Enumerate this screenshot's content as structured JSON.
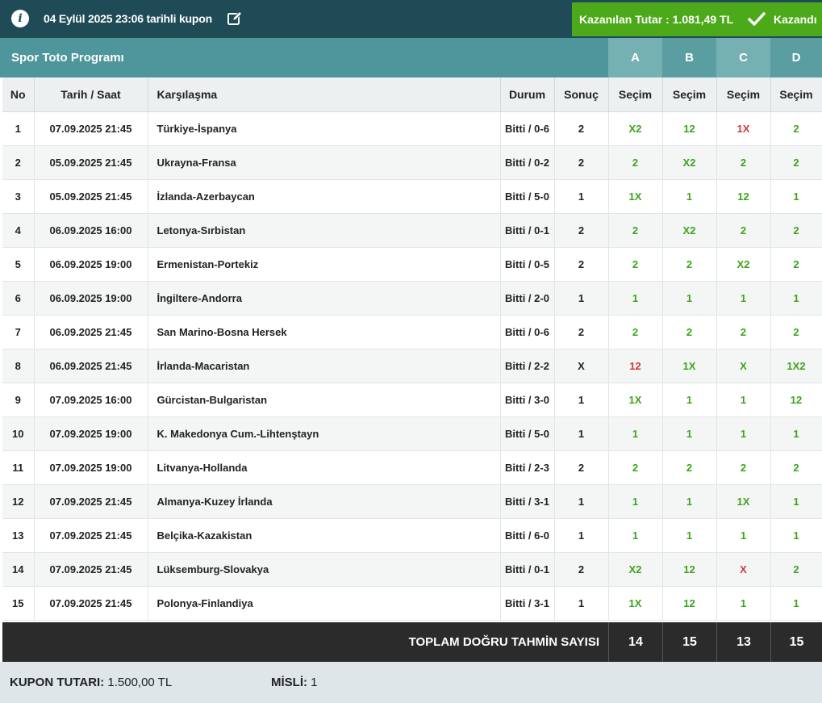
{
  "header": {
    "title": "04 Eylül 2025 23:06 tarihli kupon",
    "won_amount": "Kazanılan Tutar : 1.081,49 TL",
    "status": "Kazandı",
    "icons": [
      "info-icon",
      "edit-icon",
      "check-icon"
    ]
  },
  "program": {
    "title": "Spor Toto Programı",
    "columns": [
      "A",
      "B",
      "C",
      "D"
    ]
  },
  "table": {
    "headers": {
      "no": "No",
      "date": "Tarih / Saat",
      "match": "Karşılaşma",
      "status": "Durum",
      "result": "Sonuç",
      "pick": "Seçim"
    },
    "rows": [
      {
        "no": "1",
        "date": "07.09.2025 21:45",
        "match": "Türkiye-İspanya",
        "status": "Bitti / 0-6",
        "result": "2",
        "picks": [
          "X2",
          "12",
          "1X",
          "2"
        ]
      },
      {
        "no": "2",
        "date": "05.09.2025 21:45",
        "match": "Ukrayna-Fransa",
        "status": "Bitti / 0-2",
        "result": "2",
        "picks": [
          "2",
          "X2",
          "2",
          "2"
        ]
      },
      {
        "no": "3",
        "date": "05.09.2025 21:45",
        "match": "İzlanda-Azerbaycan",
        "status": "Bitti / 5-0",
        "result": "1",
        "picks": [
          "1X",
          "1",
          "12",
          "1"
        ]
      },
      {
        "no": "4",
        "date": "06.09.2025 16:00",
        "match": "Letonya-Sırbistan",
        "status": "Bitti / 0-1",
        "result": "2",
        "picks": [
          "2",
          "X2",
          "2",
          "2"
        ]
      },
      {
        "no": "5",
        "date": "06.09.2025 19:00",
        "match": "Ermenistan-Portekiz",
        "status": "Bitti / 0-5",
        "result": "2",
        "picks": [
          "2",
          "2",
          "X2",
          "2"
        ]
      },
      {
        "no": "6",
        "date": "06.09.2025 19:00",
        "match": "İngiltere-Andorra",
        "status": "Bitti / 2-0",
        "result": "1",
        "picks": [
          "1",
          "1",
          "1",
          "1"
        ]
      },
      {
        "no": "7",
        "date": "06.09.2025 21:45",
        "match": "San Marino-Bosna Hersek",
        "status": "Bitti / 0-6",
        "result": "2",
        "picks": [
          "2",
          "2",
          "2",
          "2"
        ]
      },
      {
        "no": "8",
        "date": "06.09.2025 21:45",
        "match": "İrlanda-Macaristan",
        "status": "Bitti / 2-2",
        "result": "X",
        "picks": [
          "12",
          "1X",
          "X",
          "1X2"
        ]
      },
      {
        "no": "9",
        "date": "07.09.2025 16:00",
        "match": "Gürcistan-Bulgaristan",
        "status": "Bitti / 3-0",
        "result": "1",
        "picks": [
          "1X",
          "1",
          "1",
          "12"
        ]
      },
      {
        "no": "10",
        "date": "07.09.2025 19:00",
        "match": "K. Makedonya Cum.-Lihtenştayn",
        "status": "Bitti / 5-0",
        "result": "1",
        "picks": [
          "1",
          "1",
          "1",
          "1"
        ]
      },
      {
        "no": "11",
        "date": "07.09.2025 19:00",
        "match": "Litvanya-Hollanda",
        "status": "Bitti / 2-3",
        "result": "2",
        "picks": [
          "2",
          "2",
          "2",
          "2"
        ]
      },
      {
        "no": "12",
        "date": "07.09.2025 21:45",
        "match": "Almanya-Kuzey İrlanda",
        "status": "Bitti / 3-1",
        "result": "1",
        "picks": [
          "1",
          "1",
          "1X",
          "1"
        ]
      },
      {
        "no": "13",
        "date": "07.09.2025 21:45",
        "match": "Belçika-Kazakistan",
        "status": "Bitti / 6-0",
        "result": "1",
        "picks": [
          "1",
          "1",
          "1",
          "1"
        ]
      },
      {
        "no": "14",
        "date": "07.09.2025 21:45",
        "match": "Lüksemburg-Slovakya",
        "status": "Bitti / 0-1",
        "result": "2",
        "picks": [
          "X2",
          "12",
          "X",
          "2"
        ]
      },
      {
        "no": "15",
        "date": "07.09.2025 21:45",
        "match": "Polonya-Finlandiya",
        "status": "Bitti / 3-1",
        "result": "1",
        "picks": [
          "1X",
          "12",
          "1",
          "1"
        ]
      }
    ]
  },
  "totals": {
    "label": "TOPLAM DOĞRU TAHMİN SAYISI",
    "values": [
      "14",
      "15",
      "13",
      "15"
    ]
  },
  "footer": {
    "kupon_label": "KUPON TUTARI:",
    "kupon_value": "1.500,00 TL",
    "misli_label": "MİSLİ:",
    "misli_value": "1"
  },
  "colors": {
    "header_bg": "#1f4b56",
    "win_green": "#4caa1a",
    "program_bar": "#4e969b",
    "correct": "#3ba41b",
    "wrong": "#d23a3a",
    "totals_bg": "#2b2b2b"
  }
}
